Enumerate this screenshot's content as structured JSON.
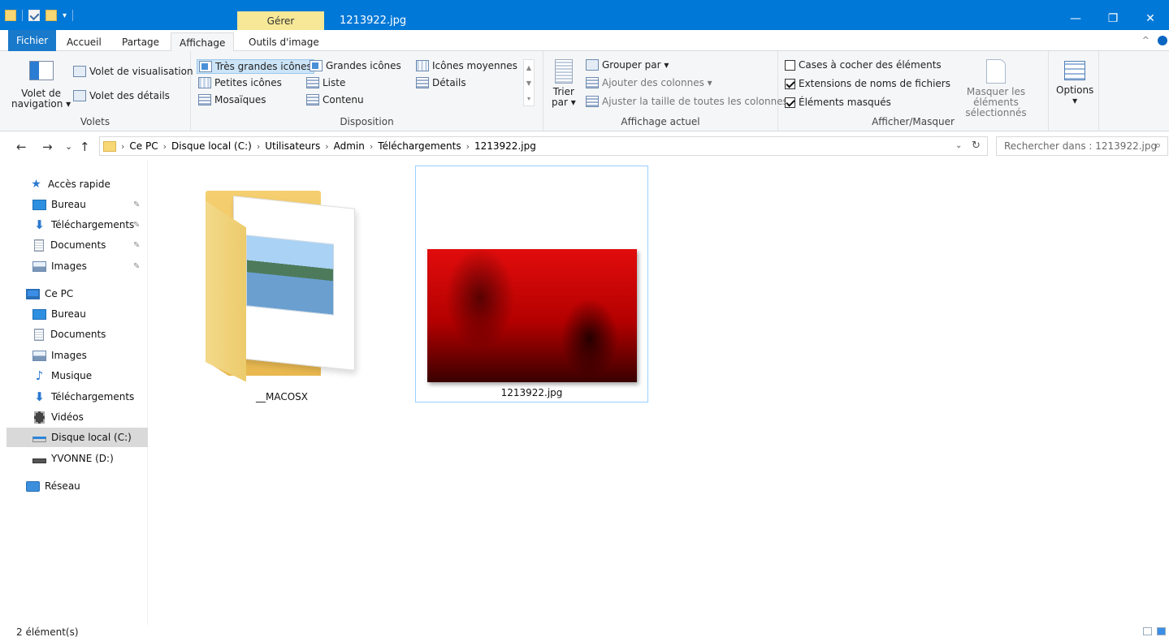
{
  "titlebar": {
    "manage_tab": "Gérer",
    "title": "1213922.jpg",
    "controls": {
      "minimize": "—",
      "maximize": "❐",
      "close": "✕"
    }
  },
  "tabs": {
    "fichier": "Fichier",
    "accueil": "Accueil",
    "partage": "Partage",
    "affichage": "Affichage",
    "outils": "Outils d'image",
    "collapse": "^"
  },
  "ribbon": {
    "volets": {
      "label": "Volets",
      "navigation_pane_line1": "Volet de",
      "navigation_pane_line2": "navigation ▾",
      "preview_pane": "Volet de visualisation",
      "details_pane": "Volet des détails"
    },
    "disposition": {
      "label": "Disposition",
      "items": [
        "Très grandes icônes",
        "Grandes icônes",
        "Icônes moyennes",
        "Petites icônes",
        "Liste",
        "Détails",
        "Mosaïques",
        "Contenu"
      ]
    },
    "affichage_actuel": {
      "label": "Affichage actuel",
      "sort_line1": "Trier",
      "sort_line2": "par ▾",
      "group_by": "Grouper par ▾",
      "add_columns": "Ajouter des colonnes ▾",
      "fit_columns": "Ajuster la taille de toutes les colonnes"
    },
    "afficher_masquer": {
      "label": "Afficher/Masquer",
      "checkboxes": [
        {
          "label": "Cases à cocher des éléments",
          "checked": false
        },
        {
          "label": "Extensions de noms de fichiers",
          "checked": true
        },
        {
          "label": "Éléments masqués",
          "checked": true
        }
      ],
      "hide_selected_line1": "Masquer les éléments",
      "hide_selected_line2": "sélectionnés"
    },
    "options": {
      "label": "Options",
      "arrow": "▾"
    }
  },
  "address": {
    "back": "←",
    "forward": "→",
    "recent": "⌄",
    "up": "↑",
    "breadcrumb": [
      "Ce PC",
      "Disque local (C:)",
      "Utilisateurs",
      "Admin",
      "Téléchargements",
      "1213922.jpg"
    ],
    "dropdown": "⌄",
    "refresh": "↻",
    "search_placeholder": "Rechercher dans : 1213922.jpg",
    "search_icon": "⌕"
  },
  "navpane": {
    "items": [
      {
        "label": "Accès rapide",
        "icon": "star-icon"
      },
      {
        "label": "Bureau",
        "icon": "desktop-icon",
        "pinned": true
      },
      {
        "label": "Téléchargements",
        "icon": "download-icon",
        "pinned": true
      },
      {
        "label": "Documents",
        "icon": "document-icon",
        "pinned": true
      },
      {
        "label": "Images",
        "icon": "pictures-icon",
        "pinned": true
      },
      {
        "label": "Ce PC",
        "icon": "computer-icon"
      },
      {
        "label": "Bureau",
        "icon": "desktop-icon"
      },
      {
        "label": "Documents",
        "icon": "document-icon"
      },
      {
        "label": "Images",
        "icon": "pictures-icon"
      },
      {
        "label": "Musique",
        "icon": "music-icon"
      },
      {
        "label": "Téléchargements",
        "icon": "download-icon"
      },
      {
        "label": "Vidéos",
        "icon": "video-icon"
      },
      {
        "label": "Disque local (C:)",
        "icon": "drive-icon",
        "selected": true
      },
      {
        "label": "YVONNE (D:)",
        "icon": "usb-drive-icon"
      },
      {
        "label": "Réseau",
        "icon": "network-icon"
      }
    ],
    "pin_glyph": "📌"
  },
  "content": {
    "items": [
      {
        "label": "__MACOSX",
        "type": "folder"
      },
      {
        "label": "1213922.jpg",
        "type": "image",
        "selected": true
      }
    ]
  },
  "status": {
    "count": "2 élément(s)"
  },
  "colors": {
    "accent": "#0078d7",
    "manage": "#f6e896",
    "file_tab": "#1979ca",
    "selection": "#99d1ff"
  }
}
